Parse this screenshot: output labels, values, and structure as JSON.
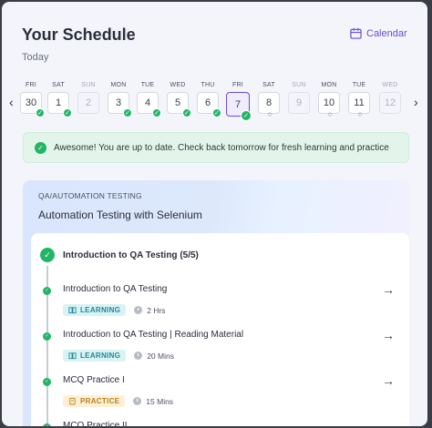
{
  "header": {
    "title": "Your Schedule",
    "subtitle": "Today",
    "calendar_label": "Calendar"
  },
  "nav": {
    "prev_icon": "chevron-left-icon"
  },
  "dates": [
    {
      "weekday": "FRI",
      "num": "30",
      "state": "done"
    },
    {
      "weekday": "SAT",
      "num": "1",
      "state": "done"
    },
    {
      "weekday": "SUN",
      "num": "2",
      "state": "future"
    },
    {
      "weekday": "MON",
      "num": "3",
      "state": "done"
    },
    {
      "weekday": "TUE",
      "num": "4",
      "state": "done"
    },
    {
      "weekday": "WED",
      "num": "5",
      "state": "done"
    },
    {
      "weekday": "THU",
      "num": "6",
      "state": "done"
    },
    {
      "weekday": "FRI",
      "num": "7",
      "state": "selected"
    },
    {
      "weekday": "SAT",
      "num": "8",
      "state": "locked"
    },
    {
      "weekday": "SUN",
      "num": "9",
      "state": "future"
    },
    {
      "weekday": "MON",
      "num": "10",
      "state": "locked"
    },
    {
      "weekday": "TUE",
      "num": "11",
      "state": "locked"
    },
    {
      "weekday": "WED",
      "num": "12",
      "state": "future"
    }
  ],
  "banner": {
    "text": "Awesome! You are up to date. Check back tomorrow for fresh learning and practice"
  },
  "course": {
    "category": "QA/AUTOMATION TESTING",
    "name": "Automation Testing with Selenium",
    "module": {
      "title": "Introduction to QA Testing (5/5)"
    },
    "items": [
      {
        "title": "Introduction to QA Testing",
        "tag": "LEARNING",
        "kind": "learn",
        "duration": "2 Hrs"
      },
      {
        "title": "Introduction to QA Testing | Reading Material",
        "tag": "LEARNING",
        "kind": "learn",
        "duration": "20 Mins"
      },
      {
        "title": "MCQ Practice I",
        "tag": "PRACTICE",
        "kind": "prac",
        "duration": "15 Mins"
      },
      {
        "title": "MCQ Practice II",
        "tag": "",
        "kind": "",
        "duration": ""
      }
    ]
  },
  "colors": {
    "accent": "#6a4bd6",
    "success": "#22b566"
  }
}
